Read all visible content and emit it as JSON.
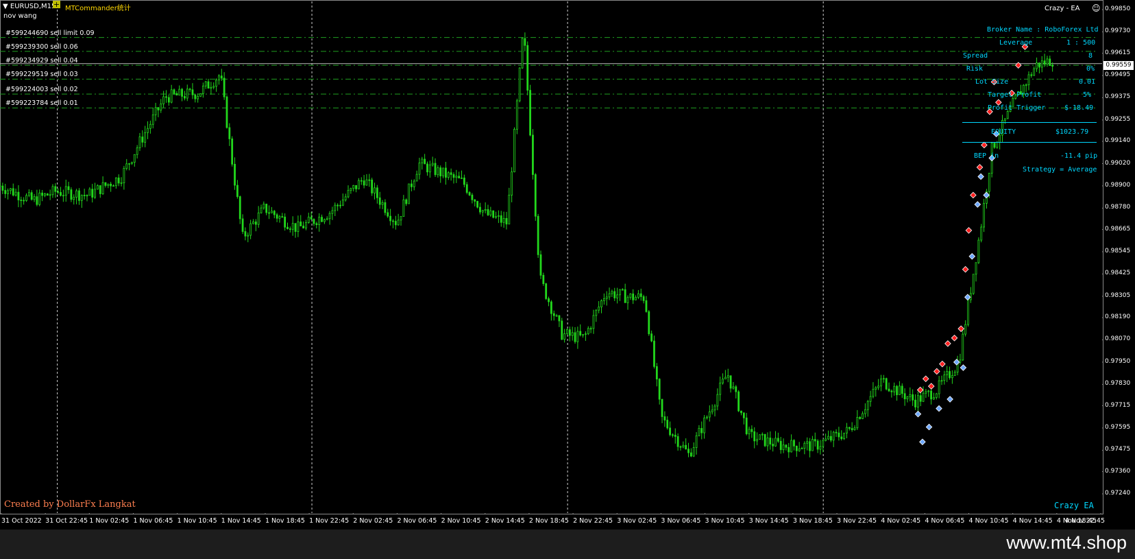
{
  "header": {
    "symbol": "EURUSD,M15",
    "add_icon": "plus-icon",
    "indicator": "MTCommander统计",
    "account_name": "nov wang",
    "ea_name": "Crazy - EA",
    "ea_face_icon": "smiley-icon"
  },
  "orders": [
    {
      "label": "#599244690 sell limit 0.09",
      "price": 0.997
    },
    {
      "label": "#599239300 sell 0.06",
      "price": 0.99625
    },
    {
      "label": "#599234929 sell 0.04",
      "price": 0.9955
    },
    {
      "label": "#599229519 sell 0.03",
      "price": 0.99475
    },
    {
      "label": "#599224003 sell 0.02",
      "price": 0.99395
    },
    {
      "label": "#599223784 sell 0.01",
      "price": 0.9932
    }
  ],
  "ea_panel": {
    "broker": "Broker Name : RoboForex Ltd",
    "leverage_label": "Leverage",
    "leverage_value": "1 : 500",
    "spread_label": "Spread",
    "spread_value": "8",
    "risk_label": "Risk",
    "risk_value": "0%",
    "lot_label": "Lot Size",
    "lot_value": "0.01",
    "target_label": "Target Profit",
    "target_value": "5%",
    "trigger_label": "Profit Trigger",
    "trigger_value": "$-18.49",
    "equity_label": "EQUITY",
    "equity_value": "$1023.79",
    "bep_label": "BEP in",
    "bep_value": "-11.4 pip",
    "strategy": "Strategy = Average"
  },
  "current_price": "0.99559",
  "price_axis": [
    "0.99850",
    "0.99730",
    "0.99615",
    "0.99495",
    "0.99375",
    "0.99255",
    "0.99140",
    "0.99020",
    "0.98900",
    "0.98780",
    "0.98665",
    "0.98545",
    "0.98425",
    "0.98305",
    "0.98190",
    "0.98070",
    "0.97950",
    "0.97830",
    "0.97715",
    "0.97595",
    "0.97475",
    "0.97360",
    "0.97240"
  ],
  "time_axis": [
    "31 Oct 2022",
    "31 Oct 22:45",
    "1 Nov 02:45",
    "1 Nov 06:45",
    "1 Nov 10:45",
    "1 Nov 14:45",
    "1 Nov 18:45",
    "1 Nov 22:45",
    "2 Nov 02:45",
    "2 Nov 06:45",
    "2 Nov 10:45",
    "2 Nov 14:45",
    "2 Nov 18:45",
    "2 Nov 22:45",
    "3 Nov 02:45",
    "3 Nov 06:45",
    "3 Nov 10:45",
    "3 Nov 14:45",
    "3 Nov 18:45",
    "3 Nov 22:45",
    "4 Nov 02:45",
    "4 Nov 06:45",
    "4 Nov 10:45",
    "4 Nov 14:45",
    "4 Nov 18:45",
    "4 Nov 22:45"
  ],
  "credit": "Created by DollarFx Langkat",
  "ea_watermark": "Crazy EA",
  "watermark_site": "www.mt4.shop",
  "colors": {
    "candle": "#22d81c",
    "order_line": "#1fa020",
    "ea_text": "#00d8ff",
    "credit": "#ff7f50",
    "marker_red": "#ff2020",
    "marker_blue": "#6fa8ff",
    "background": "#000000"
  },
  "chart_data": {
    "type": "candlestick",
    "symbol": "EURUSD",
    "timeframe": "M15",
    "ylim": [
      0.9724,
      0.9985
    ],
    "path": [
      [
        0,
        0.989
      ],
      [
        0.03,
        0.9882
      ],
      [
        0.05,
        0.9887
      ],
      [
        0.08,
        0.9885
      ],
      [
        0.11,
        0.9895
      ],
      [
        0.13,
        0.9917
      ],
      [
        0.15,
        0.9938
      ],
      [
        0.18,
        0.994
      ],
      [
        0.2,
        0.995
      ],
      [
        0.22,
        0.9862
      ],
      [
        0.24,
        0.9878
      ],
      [
        0.27,
        0.9867
      ],
      [
        0.3,
        0.9876
      ],
      [
        0.33,
        0.9894
      ],
      [
        0.36,
        0.987
      ],
      [
        0.38,
        0.9902
      ],
      [
        0.42,
        0.9892
      ],
      [
        0.44,
        0.9875
      ],
      [
        0.46,
        0.987
      ],
      [
        0.475,
        0.9975
      ],
      [
        0.49,
        0.984
      ],
      [
        0.51,
        0.981
      ],
      [
        0.53,
        0.9808
      ],
      [
        0.55,
        0.9833
      ],
      [
        0.57,
        0.983
      ],
      [
        0.585,
        0.983
      ],
      [
        0.6,
        0.9765
      ],
      [
        0.625,
        0.9745
      ],
      [
        0.66,
        0.9789
      ],
      [
        0.68,
        0.9755
      ],
      [
        0.71,
        0.975
      ],
      [
        0.74,
        0.975
      ],
      [
        0.77,
        0.9758
      ],
      [
        0.8,
        0.9785
      ],
      [
        0.83,
        0.9774
      ],
      [
        0.85,
        0.978
      ],
      [
        0.87,
        0.9795
      ],
      [
        0.89,
        0.9868
      ],
      [
        0.9,
        0.991
      ],
      [
        0.92,
        0.9935
      ],
      [
        0.94,
        0.9955
      ],
      [
        0.955,
        0.9958
      ]
    ],
    "markers": [
      {
        "t": 0.835,
        "p": 0.978,
        "side": "sell"
      },
      {
        "t": 0.84,
        "p": 0.9786,
        "side": "sell"
      },
      {
        "t": 0.845,
        "p": 0.9782,
        "side": "sell"
      },
      {
        "t": 0.85,
        "p": 0.979,
        "side": "sell"
      },
      {
        "t": 0.855,
        "p": 0.9794,
        "side": "sell"
      },
      {
        "t": 0.86,
        "p": 0.9805,
        "side": "sell"
      },
      {
        "t": 0.866,
        "p": 0.9808,
        "side": "sell"
      },
      {
        "t": 0.872,
        "p": 0.9813,
        "side": "sell"
      },
      {
        "t": 0.876,
        "p": 0.9845,
        "side": "sell"
      },
      {
        "t": 0.879,
        "p": 0.9866,
        "side": "sell"
      },
      {
        "t": 0.883,
        "p": 0.9885,
        "side": "sell"
      },
      {
        "t": 0.889,
        "p": 0.99,
        "side": "sell"
      },
      {
        "t": 0.893,
        "p": 0.9912,
        "side": "sell"
      },
      {
        "t": 0.898,
        "p": 0.993,
        "side": "sell"
      },
      {
        "t": 0.902,
        "p": 0.9946,
        "side": "sell"
      },
      {
        "t": 0.906,
        "p": 0.9935,
        "side": "sell"
      },
      {
        "t": 0.918,
        "p": 0.994,
        "side": "sell"
      },
      {
        "t": 0.924,
        "p": 0.9955,
        "side": "sell"
      },
      {
        "t": 0.93,
        "p": 0.9965,
        "side": "sell"
      },
      {
        "t": 0.833,
        "p": 0.9767,
        "side": "buy"
      },
      {
        "t": 0.837,
        "p": 0.9752,
        "side": "buy"
      },
      {
        "t": 0.843,
        "p": 0.976,
        "side": "buy"
      },
      {
        "t": 0.852,
        "p": 0.977,
        "side": "buy"
      },
      {
        "t": 0.862,
        "p": 0.9775,
        "side": "buy"
      },
      {
        "t": 0.868,
        "p": 0.9795,
        "side": "buy"
      },
      {
        "t": 0.874,
        "p": 0.9792,
        "side": "buy"
      },
      {
        "t": 0.878,
        "p": 0.983,
        "side": "buy"
      },
      {
        "t": 0.882,
        "p": 0.9852,
        "side": "buy"
      },
      {
        "t": 0.887,
        "p": 0.988,
        "side": "buy"
      },
      {
        "t": 0.89,
        "p": 0.9895,
        "side": "buy"
      },
      {
        "t": 0.895,
        "p": 0.9885,
        "side": "buy"
      },
      {
        "t": 0.9,
        "p": 0.9905,
        "side": "buy"
      },
      {
        "t": 0.904,
        "p": 0.9918,
        "side": "buy"
      }
    ]
  }
}
